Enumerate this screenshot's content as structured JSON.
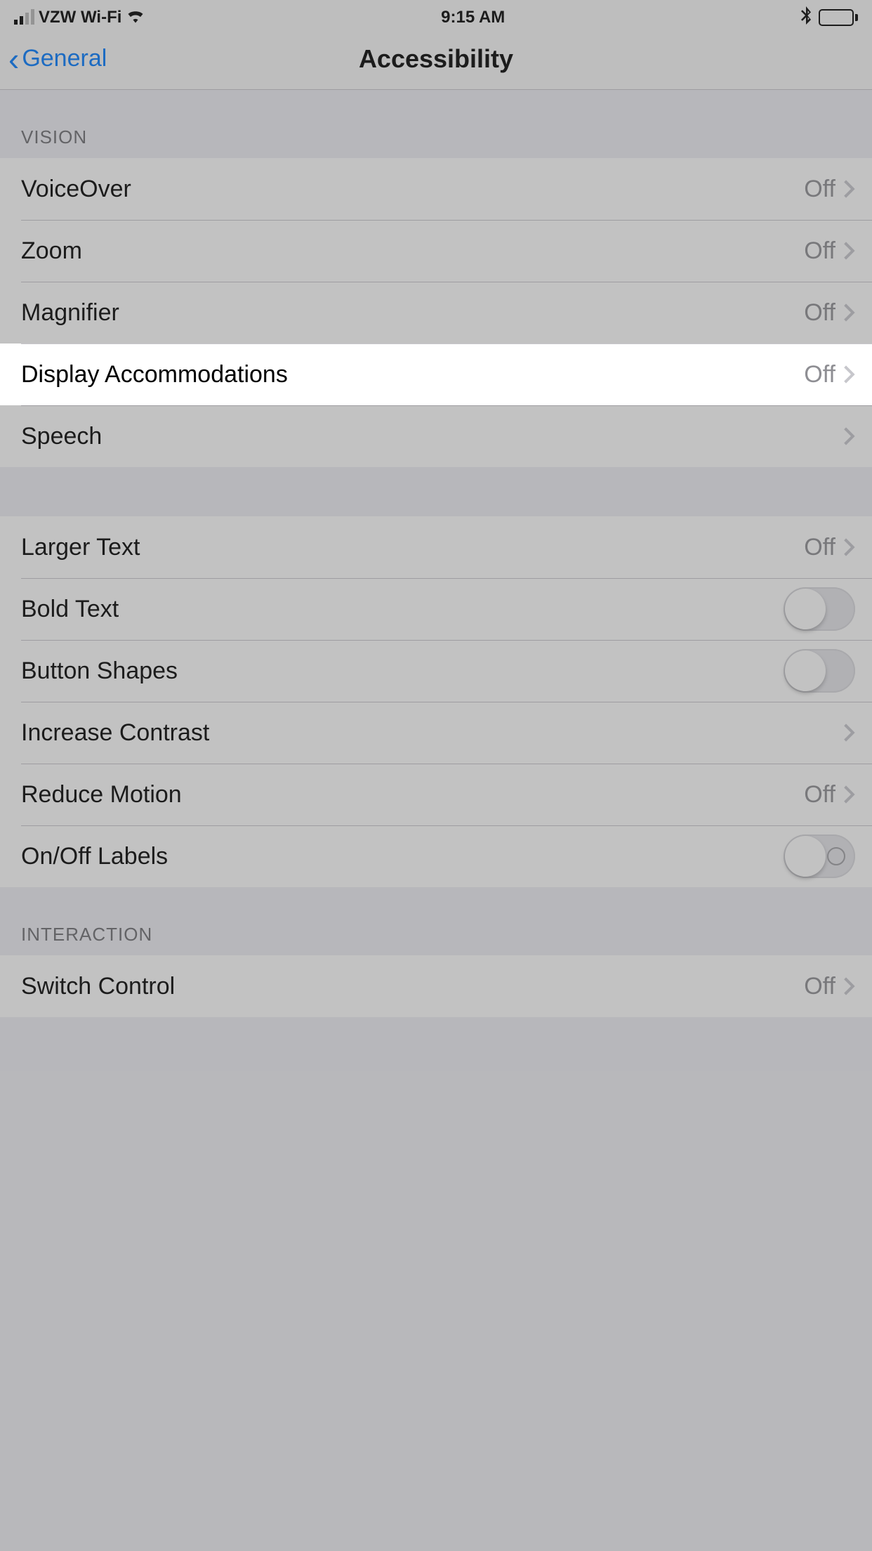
{
  "status": {
    "carrier": "VZW Wi-Fi",
    "time": "9:15 AM"
  },
  "nav": {
    "back": "General",
    "title": "Accessibility"
  },
  "sections": {
    "vision": {
      "header": "VISION",
      "voiceover": {
        "label": "VoiceOver",
        "value": "Off"
      },
      "zoom": {
        "label": "Zoom",
        "value": "Off"
      },
      "magnifier": {
        "label": "Magnifier",
        "value": "Off"
      },
      "display_accommodations": {
        "label": "Display Accommodations",
        "value": "Off"
      },
      "speech": {
        "label": "Speech"
      }
    },
    "text": {
      "larger_text": {
        "label": "Larger Text",
        "value": "Off"
      },
      "bold_text": {
        "label": "Bold Text",
        "on": false
      },
      "button_shapes": {
        "label": "Button Shapes",
        "on": false
      },
      "increase_contrast": {
        "label": "Increase Contrast"
      },
      "reduce_motion": {
        "label": "Reduce Motion",
        "value": "Off"
      },
      "onoff_labels": {
        "label": "On/Off Labels",
        "on": false
      }
    },
    "interaction": {
      "header": "INTERACTION",
      "switch_control": {
        "label": "Switch Control",
        "value": "Off"
      }
    }
  },
  "highlighted_row": "display_accommodations"
}
